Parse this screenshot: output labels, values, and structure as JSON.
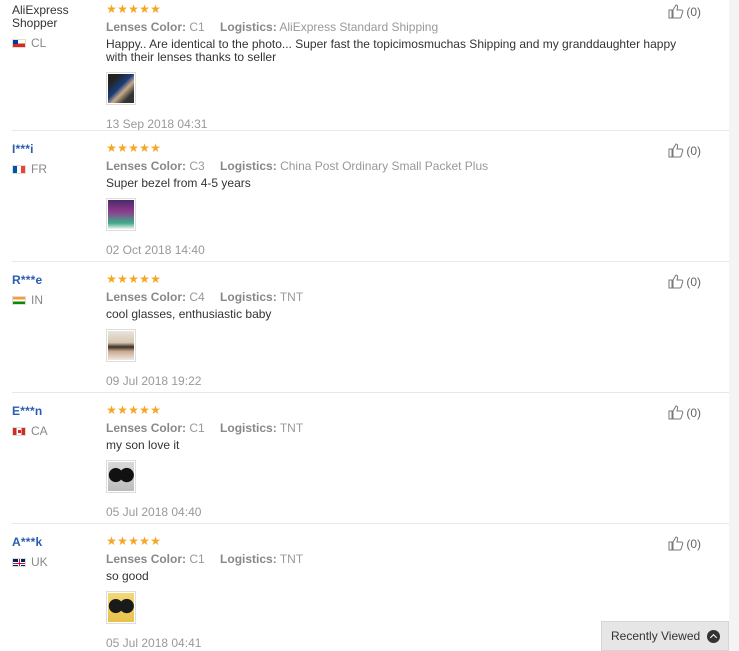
{
  "labels": {
    "color_key": "Lenses Color:",
    "logistics_key": "Logistics:"
  },
  "reviews": [
    {
      "user": "AliExpress Shopper",
      "country": "CL",
      "masked": false,
      "color": "C1",
      "logistics": "AliExpress Standard Shipping",
      "text": "Happy.. Are identical to the photo... Super fast the topicimosmuchas Shipping and my granddaughter happy with their lenses thanks to seller",
      "date": "13 Sep 2018 04:31",
      "helpful": "(0)",
      "stars": 5
    },
    {
      "user": "I***i",
      "country": "FR",
      "masked": true,
      "color": "C3",
      "logistics": "China Post Ordinary Small Packet Plus",
      "text": "Super bezel from 4-5 years",
      "date": "02 Oct 2018 14:40",
      "helpful": "(0)",
      "stars": 5
    },
    {
      "user": "R***e",
      "country": "IN",
      "masked": true,
      "color": "C4",
      "logistics": "TNT",
      "text": "cool glasses, enthusiastic baby",
      "date": "09 Jul 2018 19:22",
      "helpful": "(0)",
      "stars": 5
    },
    {
      "user": "E***n",
      "country": "CA",
      "masked": true,
      "color": "C1",
      "logistics": "TNT",
      "text": "my son love it",
      "date": "05 Jul 2018 04:40",
      "helpful": "(0)",
      "stars": 5
    },
    {
      "user": "A***k",
      "country": "UK",
      "masked": true,
      "color": "C1",
      "logistics": "TNT",
      "text": "so good",
      "date": "05 Jul 2018 04:41",
      "helpful": "(0)",
      "stars": 5
    }
  ],
  "recently_viewed": "Recently Viewed",
  "colors": {
    "star": "#f5a623",
    "masked_name": "#2a5db0"
  }
}
